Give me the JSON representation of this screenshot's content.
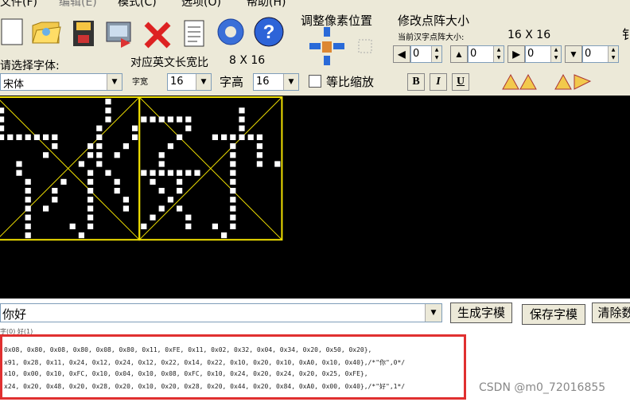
{
  "menu": [
    "文件(F)",
    "编辑(E)",
    "模式(C)",
    "选项(O)",
    "帮助(H)"
  ],
  "toolbar": {
    "pixel_pos_title": "调整像素位置",
    "dot_size_title": "修改点阵大小",
    "current_size_label": "当前汉字点阵大小:",
    "current_size_value": "16 X 16",
    "font_select_label": "请选择字体:",
    "ratio_label": "对应英文长宽比",
    "ratio_value": "8 X 16",
    "font_value": "宋体",
    "width_label": "字宽",
    "width_value": "16",
    "height_label": "字高",
    "height_value": "16",
    "proportional_label": "等比缩放",
    "bold_label": "B",
    "italic_label": "I",
    "underline_label": "U",
    "spin_values": [
      "0",
      "0",
      "0",
      "0"
    ],
    "edge_char": "钅"
  },
  "bottom": {
    "input_value": "你好",
    "gen_button": "生成字模",
    "save_button": "保存字模",
    "clear_button": "清除数",
    "status_text": "字(0)  好(1)"
  },
  "code": [
    "0x08, 0x80, 0x08, 0x80, 0x08, 0x80, 0x11, 0xFE, 0x11, 0x02, 0x32, 0x04, 0x34, 0x20, 0x50, 0x20},",
    "x91, 0x28, 0x11, 0x24, 0x12, 0x24, 0x12, 0x22, 0x14, 0x22, 0x10, 0x20, 0x10, 0xA0, 0x10, 0x40},/*\"你\",0*/",
    "x10, 0x00, 0x10, 0xFC, 0x10, 0x04, 0x10, 0x08, 0xFC, 0x10, 0x24, 0x20, 0x24, 0x20, 0x25, 0xFE},",
    "x24, 0x20, 0x48, 0x20, 0x28, 0x20, 0x10, 0x20, 0x28, 0x20, 0x44, 0x20, 0x84, 0xA0, 0x00, 0x40},/*\"好\",1*/"
  ],
  "watermark": "CSDN @m0_72016855",
  "colors": {
    "canvas": "#000000",
    "grid": "#f0e000",
    "dot": "#ffffff",
    "highlight_border": "#e03030"
  }
}
